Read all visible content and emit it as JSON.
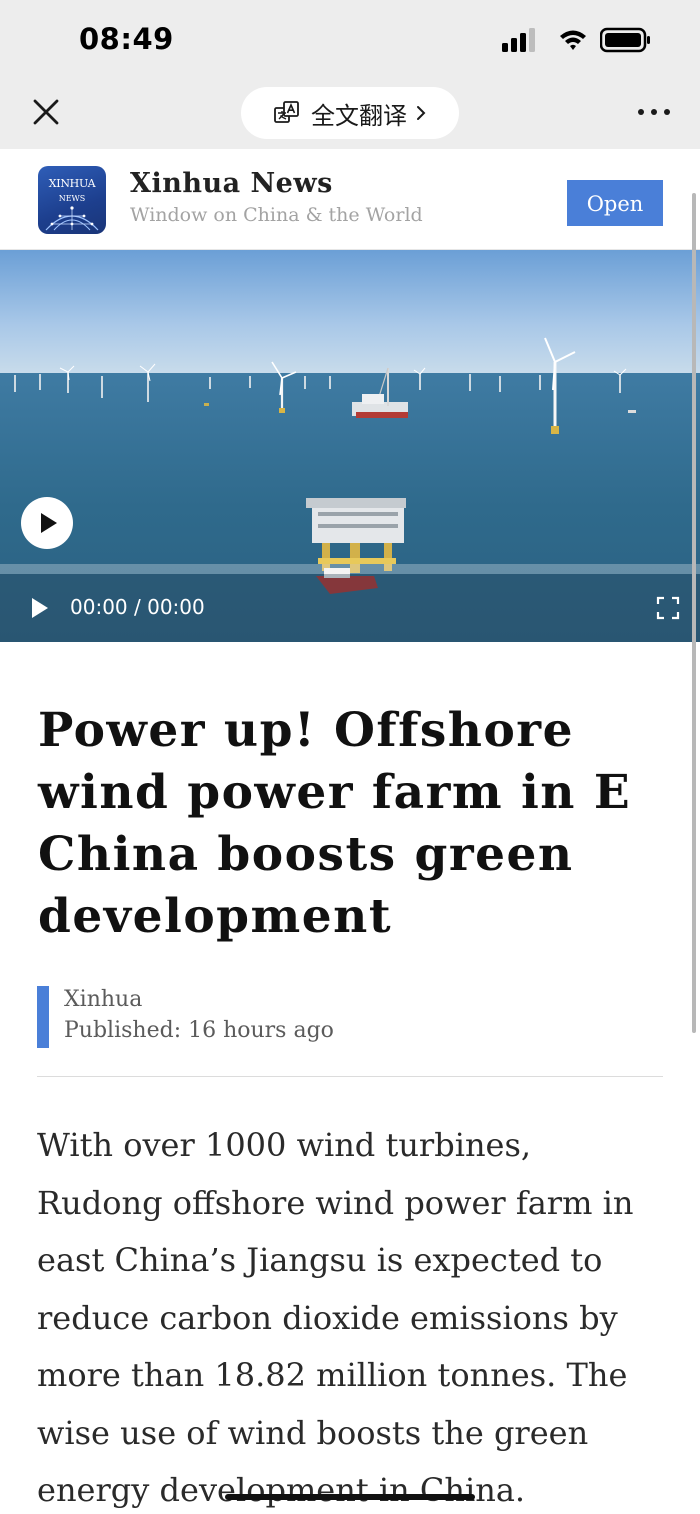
{
  "status_bar": {
    "time": "08:49"
  },
  "nav": {
    "translate_label": "全文翻译"
  },
  "publisher": {
    "logo_line1": "XINHUA",
    "logo_line2": "NEWS",
    "name": "Xinhua News",
    "tagline": "Window on China & the World",
    "open_label": "Open"
  },
  "video": {
    "time": "00:00 / 00:00",
    "progress": 0
  },
  "article": {
    "title": "Power up! Offshore wind power farm in E China boosts green development",
    "author": "Xinhua",
    "published": "Published: 16 hours ago",
    "body": "With over 1000 wind turbines, Rudong offshore wind power farm in east China’s Jiangsu is expected to reduce carbon dioxide emissions by more than 18.82 million tonnes. The wise use of wind boosts the green energy development in China."
  },
  "icons": {
    "close": "close-icon",
    "translate": "translate-icon",
    "more": "more-icon",
    "play": "play-icon",
    "fullscreen": "fullscreen-icon"
  },
  "colors": {
    "accent": "#4a7fd8",
    "chrome": "#ededed"
  }
}
